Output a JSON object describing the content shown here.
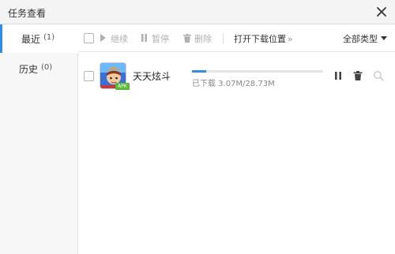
{
  "window": {
    "title": "任务查看",
    "close_icon": "close-icon"
  },
  "sidebar": {
    "items": [
      {
        "label": "最近",
        "count": "(1)",
        "active": true
      },
      {
        "label": "历史",
        "count": "(0)",
        "active": false
      }
    ]
  },
  "toolbar": {
    "continue_label": "继续",
    "pause_label": "暂停",
    "delete_label": "删除",
    "open_location_label": "打开下载位置",
    "open_location_arrow": "»",
    "filter_label": "全部类型",
    "disabled_color": "#b0b0b0"
  },
  "tasks": [
    {
      "name": "天天炫斗",
      "badge": "APK",
      "progress": 0.107,
      "progress_text": "已下载 3.07M/28.73M",
      "accent": "#2f8de4"
    }
  ]
}
